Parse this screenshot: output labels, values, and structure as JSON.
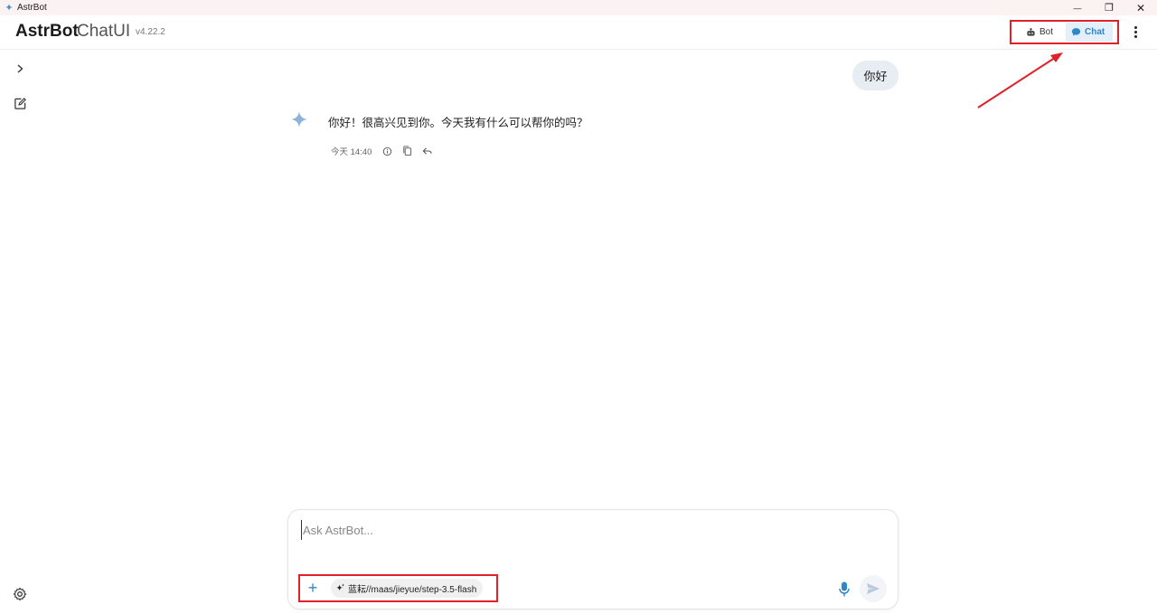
{
  "window": {
    "title": "AstrBot",
    "minimize_glyph": "—",
    "restore_glyph": "❐",
    "close_glyph": "✕"
  },
  "header": {
    "brand": "AstrBot",
    "brand_sub": "ChatUI",
    "version": "v4.22.2",
    "modes": [
      {
        "label": "Bot",
        "icon": "bot-icon",
        "active": false
      },
      {
        "label": "Chat",
        "icon": "chat-bubble-icon",
        "active": true
      }
    ]
  },
  "sidebar": {
    "items": [
      {
        "icon": "chevron-right-icon"
      },
      {
        "icon": "new-chat-icon"
      },
      {
        "icon": "settings-gear-icon"
      }
    ]
  },
  "conversation": {
    "user_message": "你好",
    "bot_message": "你好！很高兴见到你。今天我有什么可以帮你的吗？",
    "bot_time": "今天 14:40",
    "meta_icons": [
      "info-icon",
      "copy-icon",
      "reply-icon"
    ]
  },
  "composer": {
    "placeholder": "Ask AstrBot...",
    "add_label": "+",
    "model": "蓝耘//maas/jieyue/step-3.5-flash"
  },
  "colors": {
    "accent": "#2f86c9",
    "annotation": "#e0202a",
    "user_bubble": "#e8edf4",
    "active_mode_bg": "#e4f0f9"
  }
}
